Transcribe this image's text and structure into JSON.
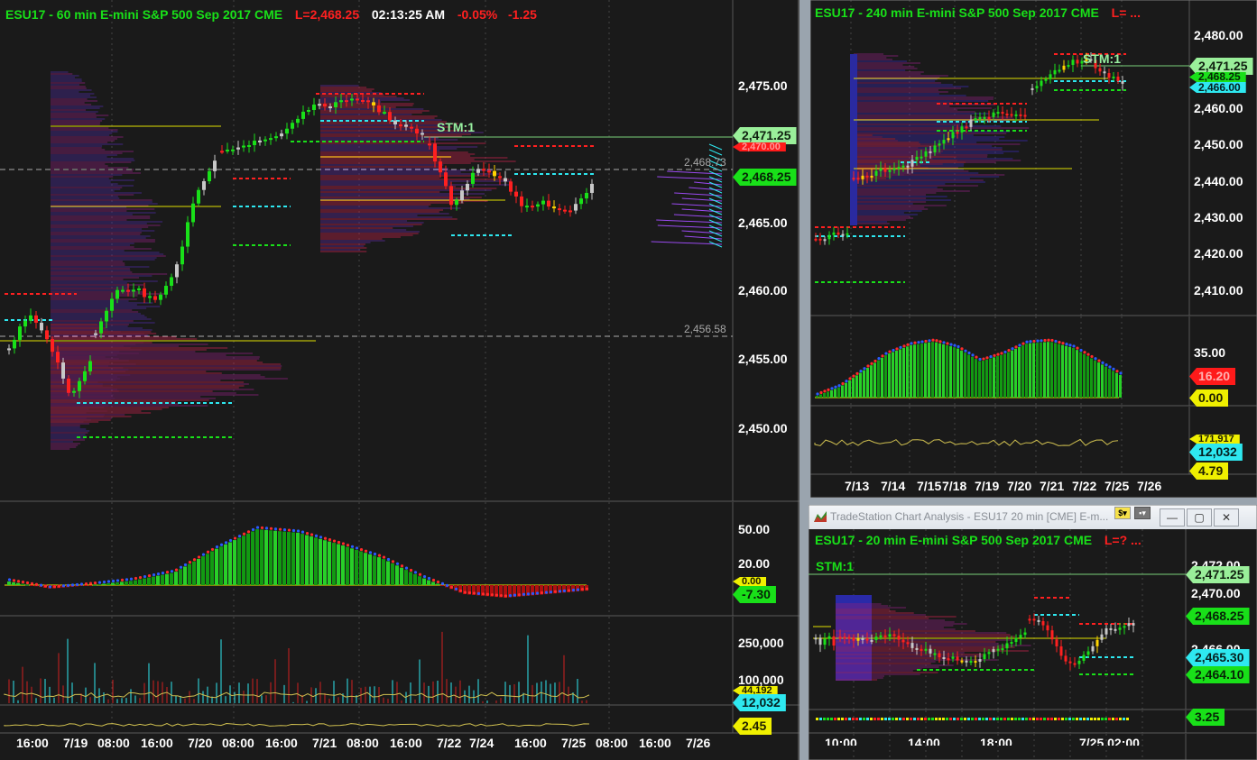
{
  "main": {
    "header": {
      "symbol": "ESU17 - 60 min  E-mini S&P 500 Sep 2017  CME",
      "last": "L=2,468.25",
      "time": "02:13:25 AM",
      "pct": "-0.05%",
      "chg": "-1.25"
    },
    "stm": "STM:1",
    "annotations": [
      "2,468.73",
      "2,456.58"
    ],
    "price_axis": [
      "2,475.00",
      "2,470.00",
      "2,465.00",
      "2,460.00",
      "2,455.00",
      "2,450.00"
    ],
    "price_tags": [
      "2,471.25",
      "2,470.00",
      "2,468.25"
    ],
    "osc_axis": [
      "50.00",
      "20.00",
      "0.00"
    ],
    "osc_tag": "-7.30",
    "vol_axis": [
      "250,000",
      "100,000",
      "44,192"
    ],
    "vol_tag": "12,032",
    "ind_tag": "2.45",
    "time_axis": [
      "16:00",
      "7/19",
      "08:00",
      "16:00",
      "7/20",
      "08:00",
      "16:00",
      "7/21",
      "08:00",
      "16:00",
      "7/22",
      "7/24",
      "16:00",
      "7/25",
      "08:00",
      "16:00",
      "7/26"
    ]
  },
  "w240": {
    "header": {
      "symbol": "ESU17 - 240 min  E-mini S&P 500 Sep 2017  CME",
      "last": "L= ..."
    },
    "stm": "STM:1",
    "price_axis": [
      "2,480.00",
      "2,470.00",
      "2,460.00",
      "2,450.00",
      "2,440.00",
      "2,430.00",
      "2,420.00",
      "2,410.00"
    ],
    "price_tags": [
      "2,471.25",
      "2,468.25",
      "2,466.00"
    ],
    "osc_axis": [
      "35.00"
    ],
    "osc_tags": [
      "16.20",
      "0.00"
    ],
    "vol_tags": [
      "171,917",
      "12,032",
      "4.79"
    ],
    "time_axis": [
      "7/13",
      "7/14",
      "7/15",
      "7/18",
      "7/19",
      "7/20",
      "7/21",
      "7/22",
      "7/25",
      "7/26"
    ]
  },
  "w20": {
    "titlebar": "TradeStation Chart Analysis - ESU17 20 min [CME] E-m...",
    "header": {
      "symbol": "ESU17 - 20 min  E-mini S&P 500 Sep 2017  CME",
      "last": "L=? ..."
    },
    "stm": "STM:1",
    "price_axis": [
      "2,472.00",
      "2,470.00",
      "2,466.00"
    ],
    "price_tags": [
      "2,471.25",
      "2,468.25",
      "2,465.30",
      "2,464.10"
    ],
    "osc_tag": "3.25",
    "time_axis": [
      "10:00",
      "14:00",
      "18:00",
      "7/25 02:00"
    ]
  },
  "colors": {
    "bg": "#1a1a1a",
    "up": "#19e019",
    "down": "#ff2020",
    "neutral": "#c8c8c8",
    "stop": "#ffd400",
    "cyan": "#2ee8f0",
    "yellow": "#f0f000",
    "profile": "#7a1f7a"
  }
}
